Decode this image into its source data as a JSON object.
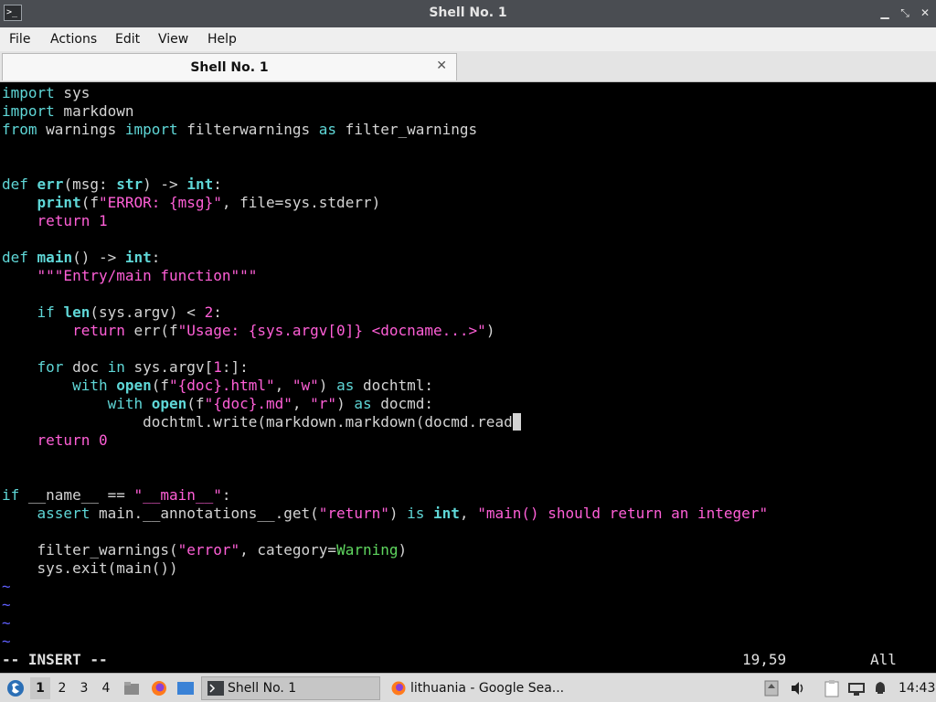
{
  "window": {
    "title": "Shell No. 1"
  },
  "menu": {
    "items": [
      "File",
      "Actions",
      "Edit",
      "View",
      "Help"
    ]
  },
  "tab": {
    "label": "Shell No. 1",
    "close": "✕"
  },
  "editor": {
    "mode": "-- INSERT --",
    "position": "19,59",
    "percent": "All"
  },
  "taskbar": {
    "workspaces": [
      "1",
      "2",
      "3",
      "4"
    ],
    "tasks": [
      {
        "label": "Shell No. 1"
      },
      {
        "label": "lithuania - Google Sea..."
      }
    ],
    "clock": "14:43"
  },
  "colors": {
    "keyword": "#5fd7d7",
    "string": "#ff5fd7",
    "builtin_exception": "#5fd75f",
    "tilde": "#5f5fff"
  }
}
